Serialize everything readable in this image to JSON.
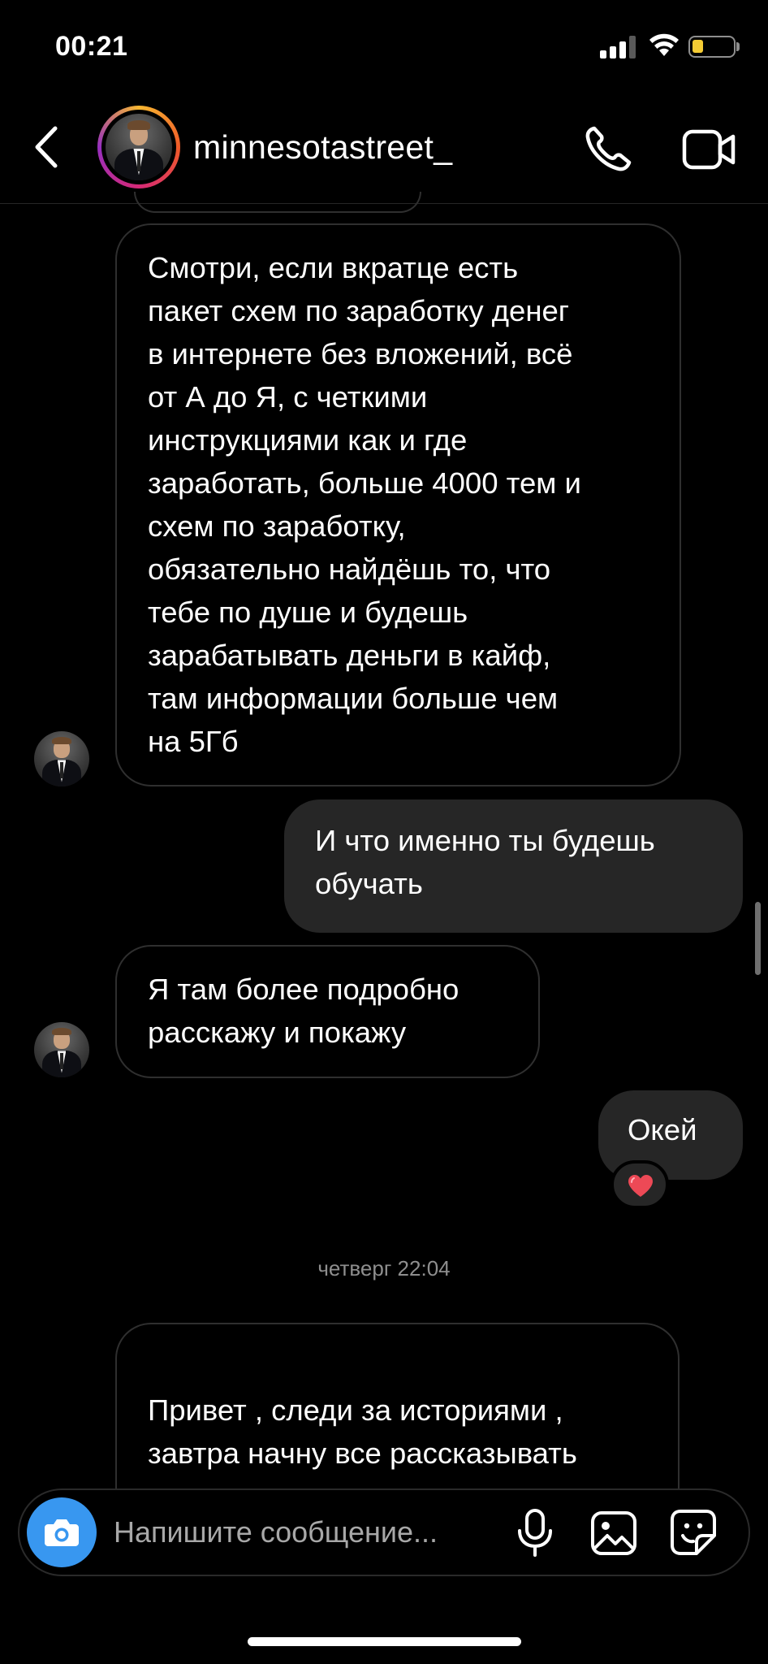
{
  "status_bar": {
    "time": "00:21"
  },
  "header": {
    "username": "minnesotastreet_"
  },
  "messages": [
    {
      "id": "m1",
      "side": "incoming",
      "text": "Смотри, если вкратце есть\nпакет схем по заработку денег\nв интернете без вложений, всё\nот А до Я, с четкими\nинструкциями как и где\nзаработать, больше 4000 тем и\nсхем по заработку,\nобязательно найдёшь то, что\nтебе по душе и будешь\nзарабатывать деньги в кайф,\nтам информации больше чем\nна 5Гб"
    },
    {
      "id": "m2",
      "side": "outgoing",
      "text": "И что именно ты будешь\nобучать"
    },
    {
      "id": "m3",
      "side": "incoming",
      "text": "Я там более подробно\nрасскажу и покажу"
    },
    {
      "id": "m4",
      "side": "outgoing",
      "text": "Окей",
      "reaction": "heart"
    },
    {
      "id": "m5",
      "side": "incoming",
      "text": "Привет , следи за историями ,\nзавтра начну все рассказывать"
    }
  ],
  "timestamp": "четверг 22:04",
  "composer": {
    "placeholder": "Напишите сообщение..."
  },
  "colors": {
    "accent_camera": "#3897f0",
    "outgoing_bubble": "#262626",
    "incoming_border": "#2f2f2f",
    "heart": "#ed4956"
  },
  "icons": [
    "back-arrow",
    "phone",
    "video-camera",
    "camera",
    "microphone",
    "gallery",
    "sticker",
    "heart",
    "handshake"
  ]
}
